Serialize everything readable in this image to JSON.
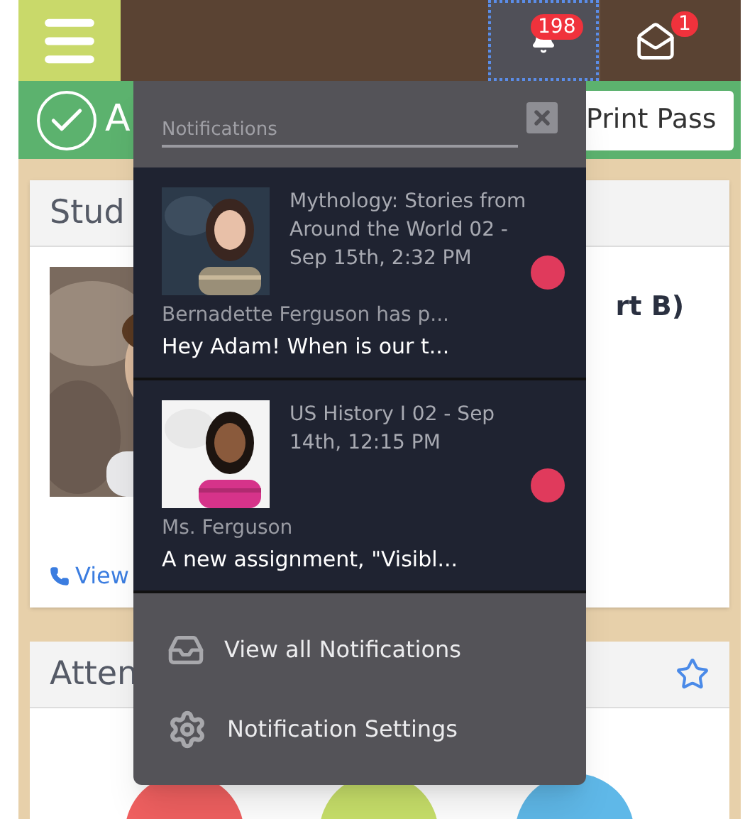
{
  "top_bar": {
    "buttons": [
      {
        "kind": "bell",
        "badge": "198",
        "selected": true
      },
      {
        "kind": "mail",
        "badge": "1",
        "selected": false
      }
    ]
  },
  "banner": {
    "text": "A",
    "button": "Print Pass"
  },
  "student_card": {
    "title": "Stud",
    "name": "rt B)",
    "link": "View"
  },
  "attendance_card": {
    "title": "Atten",
    "circles": [
      {
        "color": "#f06060"
      },
      {
        "color": "#c8e06a"
      },
      {
        "color": "#5fb8e8"
      }
    ]
  },
  "notifications_panel": {
    "search": {
      "placeholder": "Notifications"
    },
    "items": [
      {
        "title": "Mythology: Stories from Around the World 02 - Sep 15th, 2:32 PM",
        "sender": "Bernadette Ferguson has p...",
        "message": "Hey Adam! When is our t...",
        "unread": true
      },
      {
        "title": "US History I 02 - Sep 14th, 12:15 PM",
        "sender": "Ms. Ferguson",
        "message": "A new assignment, \"Visibl...",
        "unread": true
      }
    ],
    "actions": [
      {
        "kind": "inbox",
        "label": "View all Notifications"
      },
      {
        "kind": "settings",
        "label": "Notification Settings"
      }
    ]
  }
}
